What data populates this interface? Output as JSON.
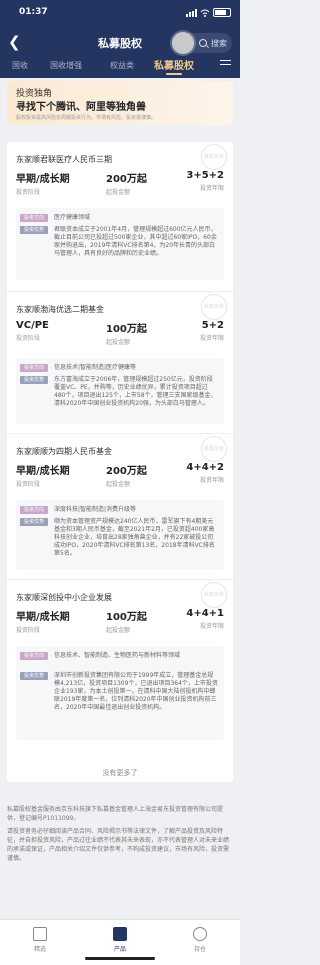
{
  "status": {
    "time": "01:37"
  },
  "nav": {
    "title": "私募股权",
    "search_label": "搜索"
  },
  "tabs": [
    {
      "label": "国收"
    },
    {
      "label": "国收增强"
    },
    {
      "label": "权益类"
    },
    {
      "label": "私募股权"
    }
  ],
  "banner": {
    "title": "投资独角",
    "subtitle": "寻找下个腾讯、阿里等独角兽",
    "note": "股权投资是高风险长周期投资行为，市场有风险，投资需谨慎。"
  },
  "products": [
    {
      "name": "东家顺君联医疗人民币三期",
      "stamp": "募集结束",
      "metrics": [
        {
          "value": "早期/成长期",
          "label": "投资阶段"
        },
        {
          "value": "200万起",
          "label": "起投金额"
        },
        {
          "value": "3+5+2",
          "label": "投资年限"
        }
      ],
      "direction_tag": "投资方向",
      "direction": "医疗健康领域",
      "advantage_tag": "投资优势",
      "advantage": "君联资本成立于2001年4月，管理规模超过600亿元人民币，截止目前公司已投超过500家企业，其中超过60家IPO，60余家并购退出，2019年清科VC排名第4，为20年长青的头部白马管理人，具有良好的品牌和历史业绩。"
    },
    {
      "name": "东家顺渤海优选二期基金",
      "stamp": "募集结束",
      "metrics": [
        {
          "value": "VC/PE",
          "label": "投资阶段"
        },
        {
          "value": "100万起",
          "label": "起投金额"
        },
        {
          "value": "5+2",
          "label": "投资年限"
        }
      ],
      "direction_tag": "投资方向",
      "direction": "信息技术|智能制造|医疗健康等",
      "advantage_tag": "投资优势",
      "advantage": "东方富海成立于2006年，管理规模超过250亿元，投资阶段覆盖VC、PE，并购等，历史业绩优异，累计投资项目超过480个，项目退出125个，上市58个，管理三支国家级基金，清科2020年中国创业投资机构20强，为头部白马管理人。"
    },
    {
      "name": "东家顺顺为四期人民币基金",
      "stamp": "募集结束",
      "metrics": [
        {
          "value": "早期/成长期",
          "label": "投资阶段"
        },
        {
          "value": "200万起",
          "label": "起投金额"
        },
        {
          "value": "4+4+2",
          "label": "投资年限"
        }
      ],
      "direction_tag": "投资方向",
      "direction": "深度科技|智能制造|消费升级等",
      "advantage_tag": "投资优势",
      "advantage": "顺为资本管理资产规模达240亿人民币，雷军旗下有4期美元基金和3期人民币基金，截至2021年2月，已投资超400家高科技创业企业，培育出28家独角兽企业，并有22家被投公司成功IPO，2020年清科VC排名第13名，2018年清科VC排名第5名。"
    },
    {
      "name": "东家顺深创投中小企业发展",
      "stamp": "募集结束",
      "metrics": [
        {
          "value": "早期/成长期",
          "label": "投资阶段"
        },
        {
          "value": "100万起",
          "label": "起投金额"
        },
        {
          "value": "4+4+1",
          "label": "投资年限"
        }
      ],
      "direction_tag": "投资方向",
      "direction": "信息技术、智能制造、生物医药与新材料等领域",
      "advantage_tag": "投资优势",
      "advantage": "深圳市创新投资集团有限公司于1999年成立，管理基金总规模4,213亿，投资项目1309个，已退出项目364个，上市投资企业193家，为本土创投第一，在清科中国大陆创投机构中蝉联2019年度第一名，位列清科2020年中国创业投资机构前三名，2020年中国最佳退出创业投资机构。"
    }
  ],
  "no_more": "没有更多了",
  "disclaimer": [
    "私募股权基金服务由京东科技旗下私募基金管理人上海金易东投资管理有限公司提供，登记编号P1011099。",
    "请投资者务必仔细阅读产品合同、风险揭示书等法律文件，了解产品投资及风险特征，并自担投资风险，产品过往业绩不代表其未来表现，亦不代表管理人对未来业绩的承诺或保证，产品相关介绍文件仅供参考，不构成投资建议，市场有风险，投资需谨慎。"
  ],
  "bottom_nav": [
    {
      "label": "精选"
    },
    {
      "label": "产品"
    },
    {
      "label": "持仓"
    }
  ]
}
